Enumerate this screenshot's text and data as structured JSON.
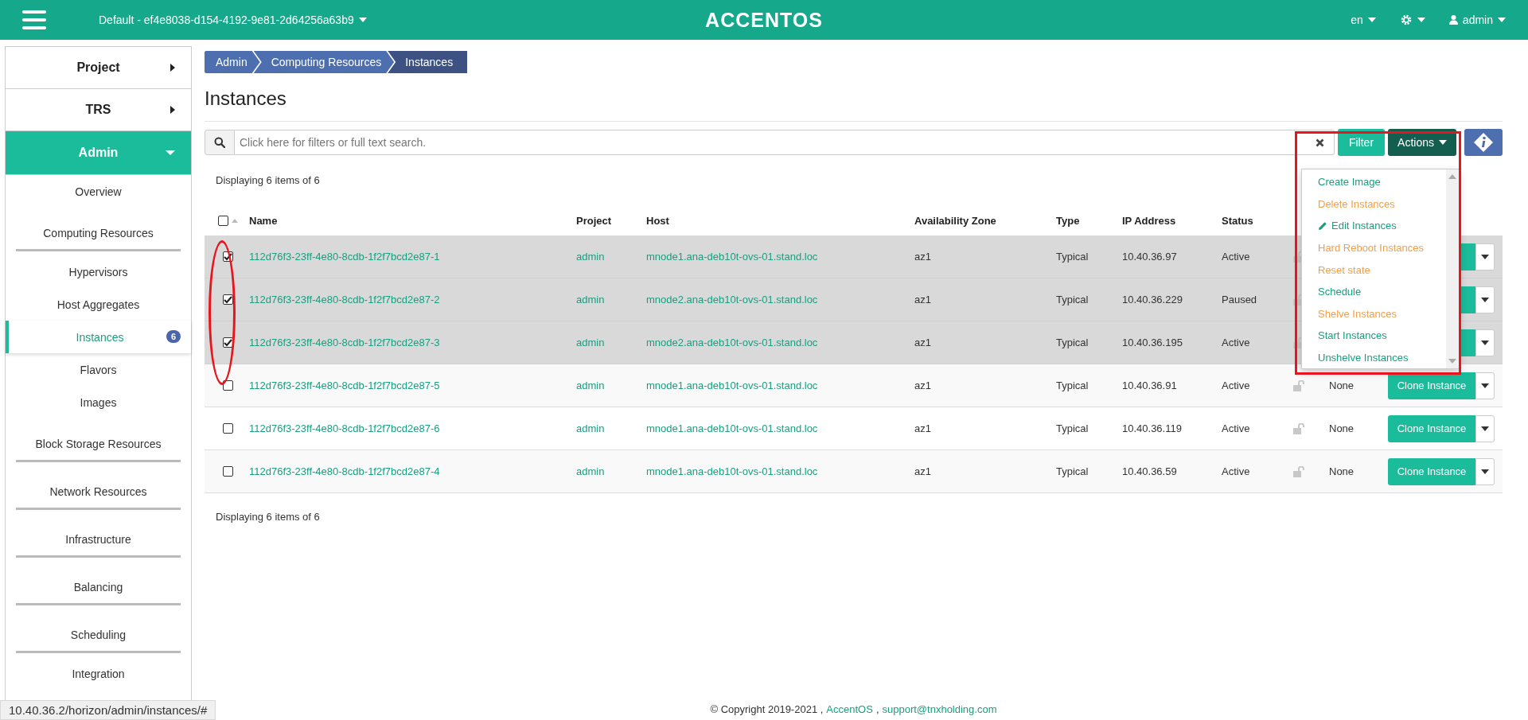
{
  "header": {
    "project": "Default - ef4e8038-d154-4192-9e81-2d64256a63b9",
    "logo": "ACCENTOS",
    "language": "en",
    "user": "admin"
  },
  "sidebar": {
    "items": [
      {
        "label": "Project",
        "expanded": false
      },
      {
        "label": "TRS",
        "expanded": false
      },
      {
        "label": "Admin",
        "expanded": true,
        "children": [
          {
            "label": "Overview",
            "kind": "item",
            "selected": false
          },
          {
            "label": "Computing Resources",
            "kind": "group",
            "selected": false
          },
          {
            "label": "Hypervisors",
            "kind": "item",
            "selected": false
          },
          {
            "label": "Host Aggregates",
            "kind": "item",
            "selected": false
          },
          {
            "label": "Instances",
            "kind": "item",
            "selected": true,
            "badge": "6"
          },
          {
            "label": "Flavors",
            "kind": "item",
            "selected": false
          },
          {
            "label": "Images",
            "kind": "item",
            "selected": false
          },
          {
            "label": "Block Storage Resources",
            "kind": "group",
            "selected": false
          },
          {
            "label": "Network Resources",
            "kind": "group",
            "selected": false
          },
          {
            "label": "Infrastructure",
            "kind": "group",
            "selected": false
          },
          {
            "label": "Balancing",
            "kind": "group",
            "selected": false
          },
          {
            "label": "Scheduling",
            "kind": "group",
            "selected": false
          },
          {
            "label": "Integration",
            "kind": "item",
            "selected": false
          }
        ]
      }
    ]
  },
  "breadcrumb": [
    "Admin",
    "Computing Resources",
    "Instances"
  ],
  "title": "Instances",
  "search": {
    "placeholder": "Click here for filters or full text search."
  },
  "toolbar": {
    "filter": "Filter",
    "actions": "Actions"
  },
  "actions_menu": [
    {
      "label": "Create Image",
      "kind": "action"
    },
    {
      "label": "Delete Instances",
      "kind": "danger"
    },
    {
      "label": "Edit Instances",
      "kind": "edit"
    },
    {
      "label": "Hard Reboot Instances",
      "kind": "danger"
    },
    {
      "label": "Reset state",
      "kind": "danger"
    },
    {
      "label": "Schedule",
      "kind": "action"
    },
    {
      "label": "Shelve Instances",
      "kind": "danger"
    },
    {
      "label": "Start Instances",
      "kind": "action"
    },
    {
      "label": "Unshelve Instances",
      "kind": "action"
    }
  ],
  "count_top": "Displaying 6 items of 6",
  "table": {
    "all_checked": false,
    "columns": [
      "Name",
      "Project",
      "Host",
      "Availability Zone",
      "Type",
      "IP Address",
      "Status"
    ],
    "rows": [
      {
        "checked": true,
        "name": "112d76f3-23ff-4e80-8cdb-1f2f7bcd2e87-1",
        "project": "admin",
        "host": "mnode1.ana-deb10t-ovs-01.stand.loc",
        "zone": "az1",
        "type": "Typical",
        "ip": "10.40.36.97",
        "status": "Active"
      },
      {
        "checked": true,
        "name": "112d76f3-23ff-4e80-8cdb-1f2f7bcd2e87-2",
        "project": "admin",
        "host": "mnode2.ana-deb10t-ovs-01.stand.loc",
        "zone": "az1",
        "type": "Typical",
        "ip": "10.40.36.229",
        "status": "Paused"
      },
      {
        "checked": true,
        "name": "112d76f3-23ff-4e80-8cdb-1f2f7bcd2e87-3",
        "project": "admin",
        "host": "mnode2.ana-deb10t-ovs-01.stand.loc",
        "zone": "az1",
        "type": "Typical",
        "ip": "10.40.36.195",
        "status": "Active"
      },
      {
        "checked": false,
        "name": "112d76f3-23ff-4e80-8cdb-1f2f7bcd2e87-5",
        "project": "admin",
        "host": "mnode1.ana-deb10t-ovs-01.stand.loc",
        "zone": "az1",
        "type": "Typical",
        "ip": "10.40.36.91",
        "status": "Active",
        "power": "None",
        "clone": "Clone Instance"
      },
      {
        "checked": false,
        "name": "112d76f3-23ff-4e80-8cdb-1f2f7bcd2e87-6",
        "project": "admin",
        "host": "mnode1.ana-deb10t-ovs-01.stand.loc",
        "zone": "az1",
        "type": "Typical",
        "ip": "10.40.36.119",
        "status": "Active",
        "power": "None",
        "clone": "Clone Instance"
      },
      {
        "checked": false,
        "name": "112d76f3-23ff-4e80-8cdb-1f2f7bcd2e87-4",
        "project": "admin",
        "host": "mnode1.ana-deb10t-ovs-01.stand.loc",
        "zone": "az1",
        "type": "Typical",
        "ip": "10.40.36.59",
        "status": "Active",
        "power": "None",
        "clone": "Clone Instance"
      }
    ]
  },
  "count_bottom": "Displaying 6 items of 6",
  "footer": {
    "text": "© Copyright 2019-2021 ,",
    "brand": "AccentOS",
    "separator": ",",
    "email": "support@tnxholding.com"
  },
  "status_bar": "10.40.36.2/horizon/admin/instances/#"
}
